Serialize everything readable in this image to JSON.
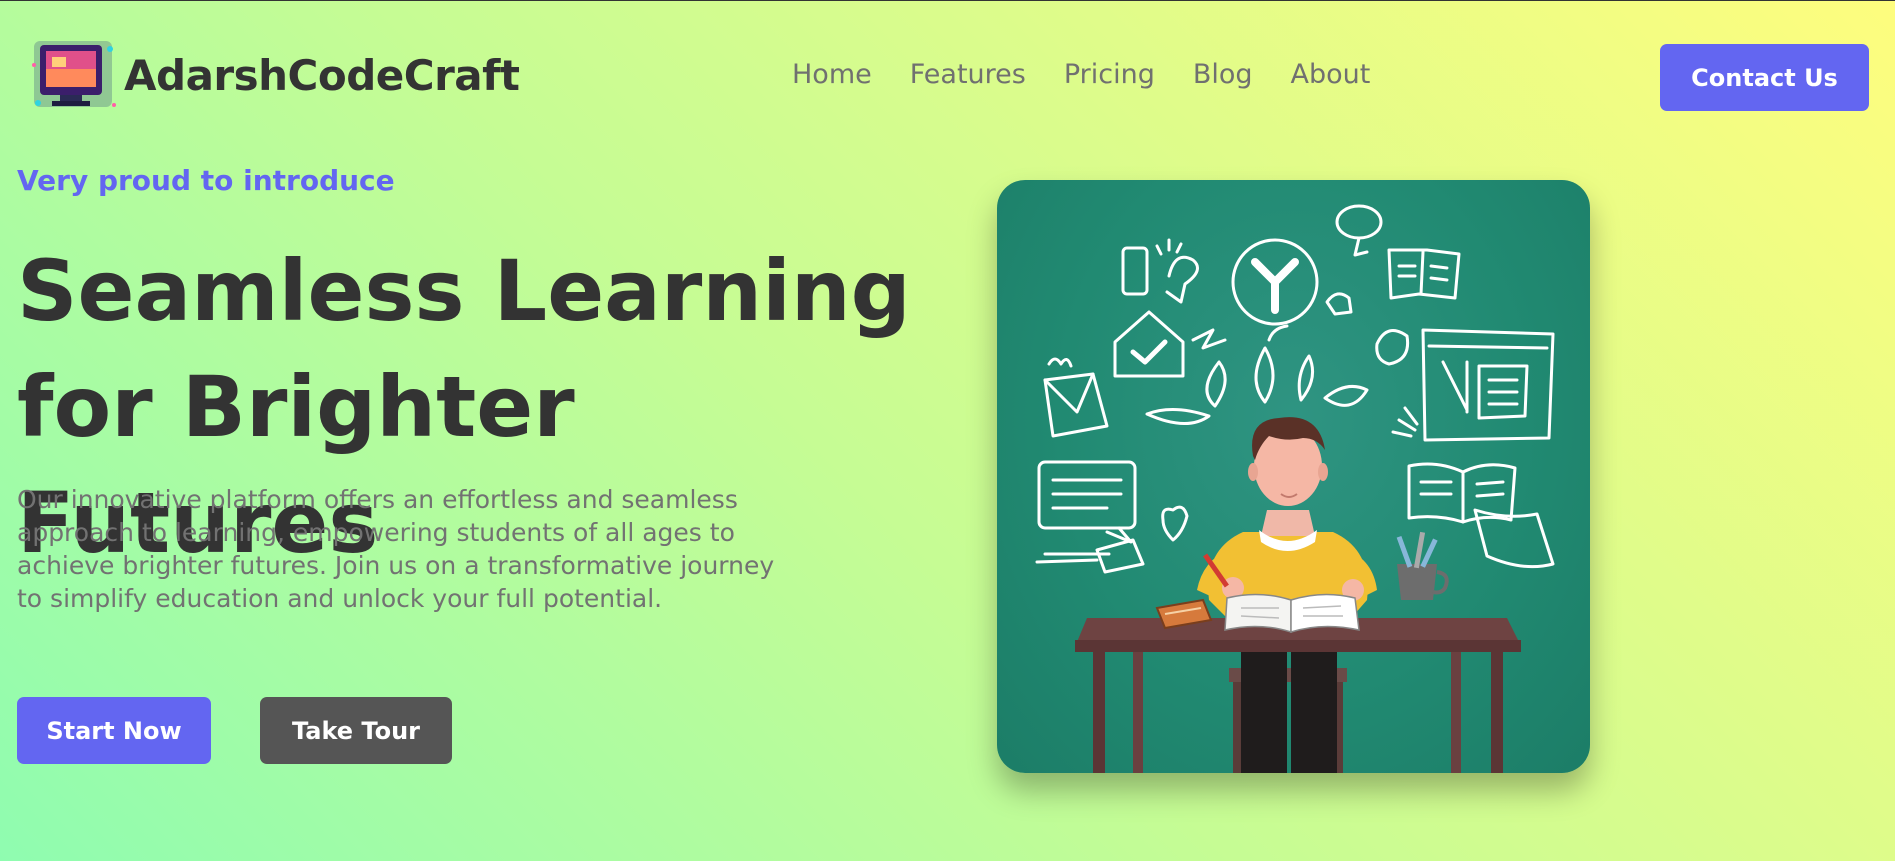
{
  "brand": {
    "name": "AdarshCodeCraft",
    "logo_icon": "retro-monitor-icon"
  },
  "nav": {
    "items": [
      "Home",
      "Features",
      "Pricing",
      "Blog",
      "About"
    ]
  },
  "header": {
    "contact_label": "Contact Us"
  },
  "hero": {
    "eyebrow": "Very proud to introduce",
    "headline_line1": "Seamless Learning",
    "headline_line2": "for Brighter Futures",
    "lead": "Our innovative platform offers an effortless and seamless approach to learning, empowering students of all ages to achieve brighter futures. Join us on a transformative journey to simplify education and unlock your full potential.",
    "primary_cta": "Start Now",
    "secondary_cta": "Take Tour",
    "illustration": "student-studying-at-desk-illustration"
  },
  "colors": {
    "accent": "#6366f1",
    "secondary_button": "#555555",
    "heading": "#333333",
    "body_text": "#727272",
    "illustration_bg": "#218a72"
  }
}
